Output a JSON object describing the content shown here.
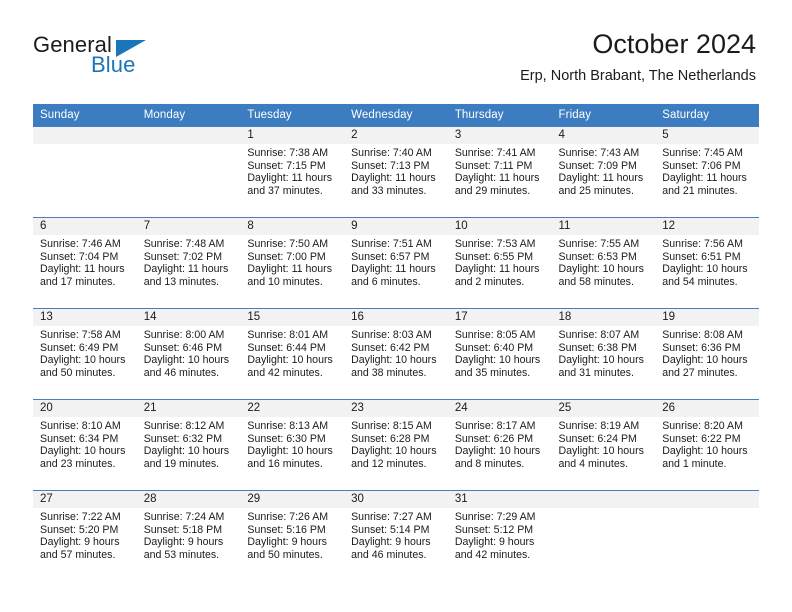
{
  "brand": {
    "name_top": "General",
    "name_bottom": "Blue",
    "accent_color": "#1b75bb"
  },
  "header": {
    "title": "October 2024",
    "subtitle": "Erp, North Brabant, The Netherlands"
  },
  "theme": {
    "header_row_color": "#3b7dc0",
    "row_separator_color": "#4a7ebb",
    "date_band_color": "#f2f2f2",
    "text_color": "#1b1b1b"
  },
  "weekday_headers": [
    "Sunday",
    "Monday",
    "Tuesday",
    "Wednesday",
    "Thursday",
    "Friday",
    "Saturday"
  ],
  "weeks": [
    [
      {
        "day": "",
        "sunrise": "",
        "sunset": "",
        "daylight_line1": "",
        "daylight_line2": ""
      },
      {
        "day": "",
        "sunrise": "",
        "sunset": "",
        "daylight_line1": "",
        "daylight_line2": ""
      },
      {
        "day": "1",
        "sunrise": "Sunrise: 7:38 AM",
        "sunset": "Sunset: 7:15 PM",
        "daylight_line1": "Daylight: 11 hours",
        "daylight_line2": "and 37 minutes."
      },
      {
        "day": "2",
        "sunrise": "Sunrise: 7:40 AM",
        "sunset": "Sunset: 7:13 PM",
        "daylight_line1": "Daylight: 11 hours",
        "daylight_line2": "and 33 minutes."
      },
      {
        "day": "3",
        "sunrise": "Sunrise: 7:41 AM",
        "sunset": "Sunset: 7:11 PM",
        "daylight_line1": "Daylight: 11 hours",
        "daylight_line2": "and 29 minutes."
      },
      {
        "day": "4",
        "sunrise": "Sunrise: 7:43 AM",
        "sunset": "Sunset: 7:09 PM",
        "daylight_line1": "Daylight: 11 hours",
        "daylight_line2": "and 25 minutes."
      },
      {
        "day": "5",
        "sunrise": "Sunrise: 7:45 AM",
        "sunset": "Sunset: 7:06 PM",
        "daylight_line1": "Daylight: 11 hours",
        "daylight_line2": "and 21 minutes."
      }
    ],
    [
      {
        "day": "6",
        "sunrise": "Sunrise: 7:46 AM",
        "sunset": "Sunset: 7:04 PM",
        "daylight_line1": "Daylight: 11 hours",
        "daylight_line2": "and 17 minutes."
      },
      {
        "day": "7",
        "sunrise": "Sunrise: 7:48 AM",
        "sunset": "Sunset: 7:02 PM",
        "daylight_line1": "Daylight: 11 hours",
        "daylight_line2": "and 13 minutes."
      },
      {
        "day": "8",
        "sunrise": "Sunrise: 7:50 AM",
        "sunset": "Sunset: 7:00 PM",
        "daylight_line1": "Daylight: 11 hours",
        "daylight_line2": "and 10 minutes."
      },
      {
        "day": "9",
        "sunrise": "Sunrise: 7:51 AM",
        "sunset": "Sunset: 6:57 PM",
        "daylight_line1": "Daylight: 11 hours",
        "daylight_line2": "and 6 minutes."
      },
      {
        "day": "10",
        "sunrise": "Sunrise: 7:53 AM",
        "sunset": "Sunset: 6:55 PM",
        "daylight_line1": "Daylight: 11 hours",
        "daylight_line2": "and 2 minutes."
      },
      {
        "day": "11",
        "sunrise": "Sunrise: 7:55 AM",
        "sunset": "Sunset: 6:53 PM",
        "daylight_line1": "Daylight: 10 hours",
        "daylight_line2": "and 58 minutes."
      },
      {
        "day": "12",
        "sunrise": "Sunrise: 7:56 AM",
        "sunset": "Sunset: 6:51 PM",
        "daylight_line1": "Daylight: 10 hours",
        "daylight_line2": "and 54 minutes."
      }
    ],
    [
      {
        "day": "13",
        "sunrise": "Sunrise: 7:58 AM",
        "sunset": "Sunset: 6:49 PM",
        "daylight_line1": "Daylight: 10 hours",
        "daylight_line2": "and 50 minutes."
      },
      {
        "day": "14",
        "sunrise": "Sunrise: 8:00 AM",
        "sunset": "Sunset: 6:46 PM",
        "daylight_line1": "Daylight: 10 hours",
        "daylight_line2": "and 46 minutes."
      },
      {
        "day": "15",
        "sunrise": "Sunrise: 8:01 AM",
        "sunset": "Sunset: 6:44 PM",
        "daylight_line1": "Daylight: 10 hours",
        "daylight_line2": "and 42 minutes."
      },
      {
        "day": "16",
        "sunrise": "Sunrise: 8:03 AM",
        "sunset": "Sunset: 6:42 PM",
        "daylight_line1": "Daylight: 10 hours",
        "daylight_line2": "and 38 minutes."
      },
      {
        "day": "17",
        "sunrise": "Sunrise: 8:05 AM",
        "sunset": "Sunset: 6:40 PM",
        "daylight_line1": "Daylight: 10 hours",
        "daylight_line2": "and 35 minutes."
      },
      {
        "day": "18",
        "sunrise": "Sunrise: 8:07 AM",
        "sunset": "Sunset: 6:38 PM",
        "daylight_line1": "Daylight: 10 hours",
        "daylight_line2": "and 31 minutes."
      },
      {
        "day": "19",
        "sunrise": "Sunrise: 8:08 AM",
        "sunset": "Sunset: 6:36 PM",
        "daylight_line1": "Daylight: 10 hours",
        "daylight_line2": "and 27 minutes."
      }
    ],
    [
      {
        "day": "20",
        "sunrise": "Sunrise: 8:10 AM",
        "sunset": "Sunset: 6:34 PM",
        "daylight_line1": "Daylight: 10 hours",
        "daylight_line2": "and 23 minutes."
      },
      {
        "day": "21",
        "sunrise": "Sunrise: 8:12 AM",
        "sunset": "Sunset: 6:32 PM",
        "daylight_line1": "Daylight: 10 hours",
        "daylight_line2": "and 19 minutes."
      },
      {
        "day": "22",
        "sunrise": "Sunrise: 8:13 AM",
        "sunset": "Sunset: 6:30 PM",
        "daylight_line1": "Daylight: 10 hours",
        "daylight_line2": "and 16 minutes."
      },
      {
        "day": "23",
        "sunrise": "Sunrise: 8:15 AM",
        "sunset": "Sunset: 6:28 PM",
        "daylight_line1": "Daylight: 10 hours",
        "daylight_line2": "and 12 minutes."
      },
      {
        "day": "24",
        "sunrise": "Sunrise: 8:17 AM",
        "sunset": "Sunset: 6:26 PM",
        "daylight_line1": "Daylight: 10 hours",
        "daylight_line2": "and 8 minutes."
      },
      {
        "day": "25",
        "sunrise": "Sunrise: 8:19 AM",
        "sunset": "Sunset: 6:24 PM",
        "daylight_line1": "Daylight: 10 hours",
        "daylight_line2": "and 4 minutes."
      },
      {
        "day": "26",
        "sunrise": "Sunrise: 8:20 AM",
        "sunset": "Sunset: 6:22 PM",
        "daylight_line1": "Daylight: 10 hours",
        "daylight_line2": "and 1 minute."
      }
    ],
    [
      {
        "day": "27",
        "sunrise": "Sunrise: 7:22 AM",
        "sunset": "Sunset: 5:20 PM",
        "daylight_line1": "Daylight: 9 hours",
        "daylight_line2": "and 57 minutes."
      },
      {
        "day": "28",
        "sunrise": "Sunrise: 7:24 AM",
        "sunset": "Sunset: 5:18 PM",
        "daylight_line1": "Daylight: 9 hours",
        "daylight_line2": "and 53 minutes."
      },
      {
        "day": "29",
        "sunrise": "Sunrise: 7:26 AM",
        "sunset": "Sunset: 5:16 PM",
        "daylight_line1": "Daylight: 9 hours",
        "daylight_line2": "and 50 minutes."
      },
      {
        "day": "30",
        "sunrise": "Sunrise: 7:27 AM",
        "sunset": "Sunset: 5:14 PM",
        "daylight_line1": "Daylight: 9 hours",
        "daylight_line2": "and 46 minutes."
      },
      {
        "day": "31",
        "sunrise": "Sunrise: 7:29 AM",
        "sunset": "Sunset: 5:12 PM",
        "daylight_line1": "Daylight: 9 hours",
        "daylight_line2": "and 42 minutes."
      },
      {
        "day": "",
        "sunrise": "",
        "sunset": "",
        "daylight_line1": "",
        "daylight_line2": ""
      },
      {
        "day": "",
        "sunrise": "",
        "sunset": "",
        "daylight_line1": "",
        "daylight_line2": ""
      }
    ]
  ]
}
